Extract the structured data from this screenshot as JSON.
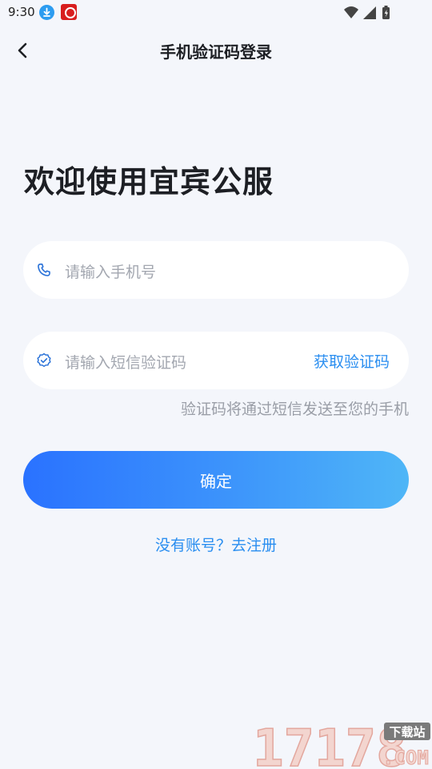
{
  "status_bar": {
    "time": "9:30",
    "icons": [
      "download-icon",
      "app-notification-icon",
      "wifi-icon",
      "signal-icon",
      "battery-icon"
    ]
  },
  "nav": {
    "title": "手机验证码登录",
    "back_icon": "chevron-left-icon"
  },
  "welcome_title": "欢迎使用宜宾公服",
  "phone_field": {
    "icon": "phone-icon",
    "placeholder": "请输入手机号",
    "value": ""
  },
  "code_field": {
    "icon": "shield-check-icon",
    "placeholder": "请输入短信验证码",
    "value": "",
    "get_code_label": "获取验证码"
  },
  "hint_text": "验证码将通过短信发送至您的手机",
  "confirm_label": "确定",
  "register_link": "没有账号？去注册",
  "watermark": {
    "number": "17178",
    "badge": "下载站",
    "suffix": ".COM"
  },
  "colors": {
    "accent": "#2a8ef0",
    "button_gradient_start": "#2a72ff",
    "button_gradient_end": "#4fb6f7",
    "background": "#f4f6fb",
    "watermark": "#d9534f"
  }
}
